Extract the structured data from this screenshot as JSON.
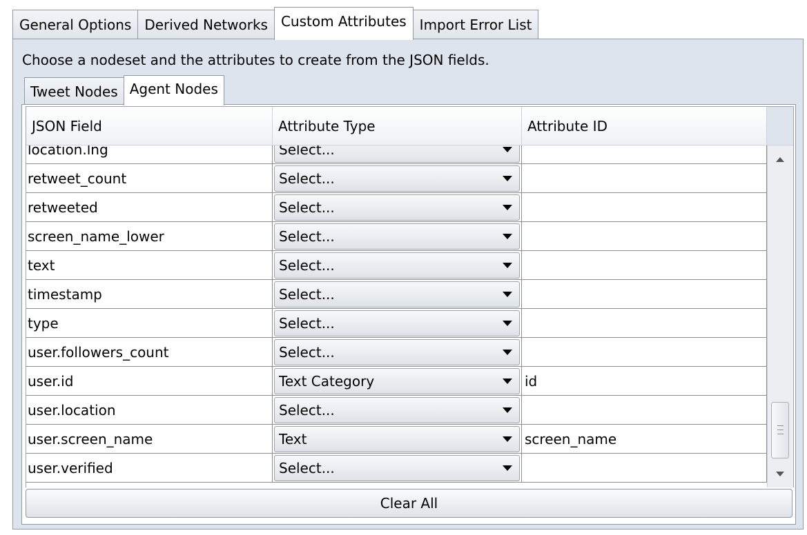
{
  "outer_tabs": [
    {
      "label": "General Options"
    },
    {
      "label": "Derived Networks"
    },
    {
      "label": "Custom Attributes"
    },
    {
      "label": "Import Error List"
    }
  ],
  "active_outer_tab": "Custom Attributes",
  "instruction": "Choose a nodeset and the attributes to create from the JSON fields.",
  "sub_tabs": [
    {
      "label": "Tweet Nodes"
    },
    {
      "label": "Agent Nodes"
    }
  ],
  "active_sub_tab": "Agent Nodes",
  "table": {
    "headers": [
      "JSON Field",
      "Attribute Type",
      "Attribute ID"
    ],
    "rows": [
      {
        "field": "location.lng",
        "type": "Select...",
        "id": ""
      },
      {
        "field": "retweet_count",
        "type": "Select...",
        "id": ""
      },
      {
        "field": "retweeted",
        "type": "Select...",
        "id": ""
      },
      {
        "field": "screen_name_lower",
        "type": "Select...",
        "id": ""
      },
      {
        "field": "text",
        "type": "Select...",
        "id": ""
      },
      {
        "field": "timestamp",
        "type": "Select...",
        "id": ""
      },
      {
        "field": "type",
        "type": "Select...",
        "id": ""
      },
      {
        "field": "user.followers_count",
        "type": "Select...",
        "id": ""
      },
      {
        "field": "user.id",
        "type": "Text Category",
        "id": "id"
      },
      {
        "field": "user.location",
        "type": "Select...",
        "id": ""
      },
      {
        "field": "user.screen_name",
        "type": "Text",
        "id": "screen_name"
      },
      {
        "field": "user.verified",
        "type": "Select...",
        "id": ""
      }
    ]
  },
  "clear_button": "Clear All",
  "icons": {
    "scroll_up": "arrow-up-icon",
    "scroll_down": "arrow-down-icon",
    "combo_arrow": "dropdown-arrow-icon"
  }
}
